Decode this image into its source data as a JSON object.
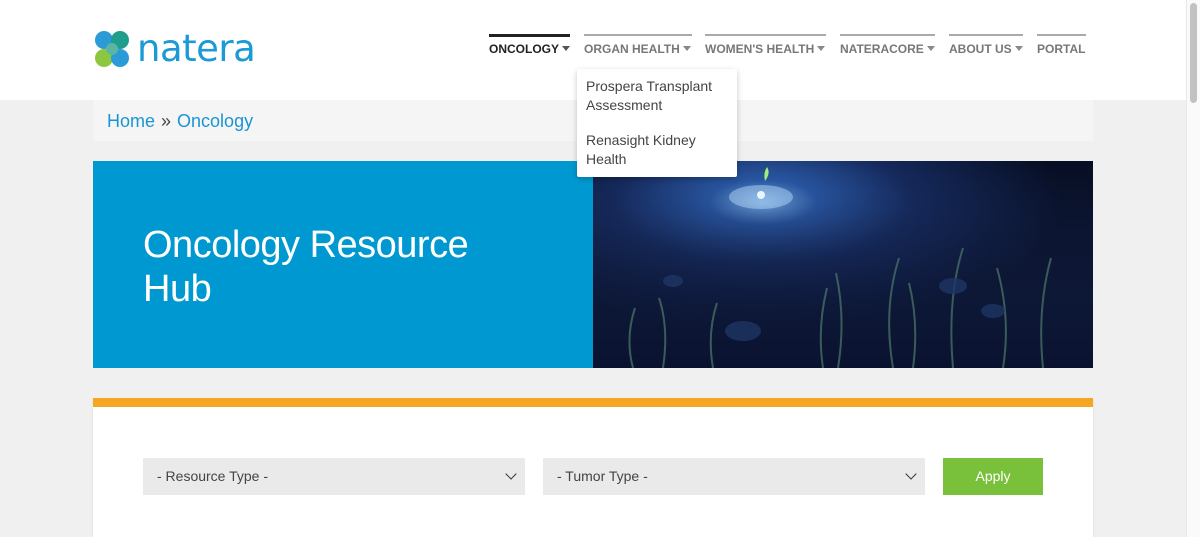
{
  "brand": {
    "name": "natera",
    "accent": "#1c9ad6"
  },
  "nav": {
    "items": [
      {
        "label": "ONCOLOGY"
      },
      {
        "label": "ORGAN HEALTH"
      },
      {
        "label": "WOMEN'S HEALTH"
      },
      {
        "label": "NATERACORE"
      },
      {
        "label": "ABOUT US"
      },
      {
        "label": "PORTAL"
      }
    ],
    "active": "ONCOLOGY",
    "dropdown": {
      "parent": "ORGAN HEALTH",
      "items": [
        {
          "label": "Prospera Transplant Assessment"
        },
        {
          "label": "Renasight Kidney Health"
        }
      ]
    }
  },
  "breadcrumb": {
    "home": "Home",
    "separator": "»",
    "current": "Oncology"
  },
  "hero": {
    "title": "Oncology Resource Hub",
    "background": "#0098d1"
  },
  "filters": {
    "resource_type": {
      "selected": "- Resource Type -"
    },
    "tumor_type": {
      "selected": "- Tumor Type -"
    },
    "apply_label": "Apply",
    "apply_color": "#79c13a",
    "panel_accent": "#f5a623"
  }
}
